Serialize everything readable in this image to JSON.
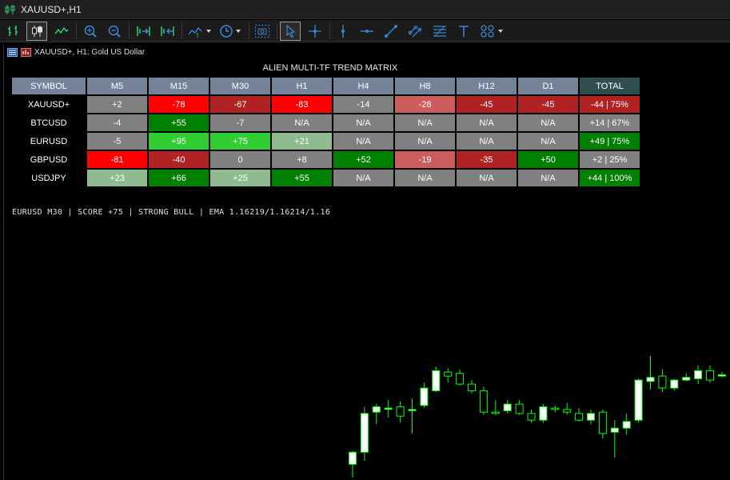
{
  "window": {
    "title": "XAUUSD+,H1"
  },
  "chart_header": {
    "text": "XAUUSD+, H1:  Gold US Dollar"
  },
  "matrix": {
    "title": "ALIEN MULTI-TF TREND MATRIX",
    "headers": [
      "SYMBOL",
      "M5",
      "M15",
      "M30",
      "H1",
      "H4",
      "H8",
      "H12",
      "D1",
      "TOTAL"
    ],
    "rows": [
      {
        "symbol": "XAUUSD+",
        "cells": [
          {
            "v": "+2",
            "c": "#808080"
          },
          {
            "v": "-78",
            "c": "#ff0000"
          },
          {
            "v": "-67",
            "c": "#b22222"
          },
          {
            "v": "-83",
            "c": "#ff0000"
          },
          {
            "v": "-14",
            "c": "#808080"
          },
          {
            "v": "-28",
            "c": "#cd5c5c"
          },
          {
            "v": "-45",
            "c": "#b22222"
          },
          {
            "v": "-45",
            "c": "#b22222"
          }
        ],
        "total": {
          "v": "-44 | 75%",
          "c": "#b22222"
        }
      },
      {
        "symbol": "BTCUSD",
        "cells": [
          {
            "v": "-4",
            "c": "#808080"
          },
          {
            "v": "+55",
            "c": "#008000"
          },
          {
            "v": "-7",
            "c": "#808080"
          },
          {
            "v": "N/A",
            "c": "#808080"
          },
          {
            "v": "N/A",
            "c": "#808080"
          },
          {
            "v": "N/A",
            "c": "#808080"
          },
          {
            "v": "N/A",
            "c": "#808080"
          },
          {
            "v": "N/A",
            "c": "#808080"
          }
        ],
        "total": {
          "v": "+14 | 67%",
          "c": "#808080"
        }
      },
      {
        "symbol": "EURUSD",
        "cells": [
          {
            "v": "-5",
            "c": "#808080"
          },
          {
            "v": "+95",
            "c": "#32cd32"
          },
          {
            "v": "+75",
            "c": "#32cd32"
          },
          {
            "v": "+21",
            "c": "#8fbc8f"
          },
          {
            "v": "N/A",
            "c": "#808080"
          },
          {
            "v": "N/A",
            "c": "#808080"
          },
          {
            "v": "N/A",
            "c": "#808080"
          },
          {
            "v": "N/A",
            "c": "#808080"
          }
        ],
        "total": {
          "v": "+49 | 75%",
          "c": "#008000"
        }
      },
      {
        "symbol": "GBPUSD",
        "cells": [
          {
            "v": "-81",
            "c": "#ff0000"
          },
          {
            "v": "-40",
            "c": "#b22222"
          },
          {
            "v": "0",
            "c": "#808080"
          },
          {
            "v": "+8",
            "c": "#808080"
          },
          {
            "v": "+52",
            "c": "#008000"
          },
          {
            "v": "-19",
            "c": "#cd5c5c"
          },
          {
            "v": "-35",
            "c": "#b22222"
          },
          {
            "v": "+50",
            "c": "#008000"
          }
        ],
        "total": {
          "v": "+2 | 25%",
          "c": "#808080"
        }
      },
      {
        "symbol": "USDJPY",
        "cells": [
          {
            "v": "+23",
            "c": "#8fbc8f"
          },
          {
            "v": "+66",
            "c": "#008000"
          },
          {
            "v": "+25",
            "c": "#8fbc8f"
          },
          {
            "v": "+55",
            "c": "#008000"
          },
          {
            "v": "N/A",
            "c": "#808080"
          },
          {
            "v": "N/A",
            "c": "#808080"
          },
          {
            "v": "N/A",
            "c": "#808080"
          },
          {
            "v": "N/A",
            "c": "#808080"
          }
        ],
        "total": {
          "v": "+44 | 100%",
          "c": "#008000"
        }
      }
    ]
  },
  "status": {
    "text": "EURUSD M30 | SCORE +75 | STRONG BULL | EMA 1.16219/1.16214/1.16"
  },
  "toolbar": {
    "icons": [
      "bar-chart-icon",
      "candlestick-icon",
      "line-chart-icon",
      "zoom-in-icon",
      "zoom-out-icon",
      "chart-shift-icon",
      "autoscroll-icon",
      "indicators-icon",
      "periods-icon",
      "screenshot-icon",
      "cursor-icon",
      "crosshair-icon",
      "vertical-line-icon",
      "horizontal-line-icon",
      "trendline-icon",
      "channel-icon",
      "fibonacci-icon",
      "text-icon",
      "shapes-icon"
    ]
  },
  "colors": {
    "accent": "#3a86d8",
    "bull_candle": "#ffffff",
    "wick": "#00ff00",
    "background": "#000000"
  },
  "candles": [
    {
      "o": 2.0,
      "h": 4.0,
      "l": 0,
      "c": 3.8
    },
    {
      "o": 3.8,
      "h": 10.6,
      "l": 2.5,
      "c": 9.6
    },
    {
      "o": 9.8,
      "h": 11.0,
      "l": 8.0,
      "c": 10.6
    },
    {
      "o": 10.4,
      "h": 11.6,
      "l": 9.0,
      "c": 10.4
    },
    {
      "o": 10.6,
      "h": 11.4,
      "l": 8.2,
      "c": 9.2
    },
    {
      "o": 10.2,
      "h": 11.8,
      "l": 6.6,
      "c": 10.2
    },
    {
      "o": 10.8,
      "h": 14.2,
      "l": 10.5,
      "c": 13.4
    },
    {
      "o": 13.0,
      "h": 16.6,
      "l": 12.8,
      "c": 16.0
    },
    {
      "o": 15.8,
      "h": 16.4,
      "l": 14.2,
      "c": 15.2
    },
    {
      "o": 15.6,
      "h": 16.2,
      "l": 13.8,
      "c": 14.0
    },
    {
      "o": 14.0,
      "h": 14.6,
      "l": 12.6,
      "c": 13.0
    },
    {
      "o": 13.0,
      "h": 13.6,
      "l": 9.4,
      "c": 9.8
    },
    {
      "o": 9.8,
      "h": 11.6,
      "l": 9.4,
      "c": 9.6
    },
    {
      "o": 10.0,
      "h": 11.6,
      "l": 9.6,
      "c": 11.0
    },
    {
      "o": 11.0,
      "h": 11.6,
      "l": 9.4,
      "c": 9.6
    },
    {
      "o": 9.6,
      "h": 10.2,
      "l": 8.2,
      "c": 8.6
    },
    {
      "o": 8.6,
      "h": 11.0,
      "l": 8.2,
      "c": 10.6
    },
    {
      "o": 10.4,
      "h": 10.8,
      "l": 9.8,
      "c": 10.2
    },
    {
      "o": 10.2,
      "h": 11.2,
      "l": 9.4,
      "c": 9.8
    },
    {
      "o": 9.6,
      "h": 10.4,
      "l": 8.4,
      "c": 8.6
    },
    {
      "o": 8.6,
      "h": 10.2,
      "l": 8.0,
      "c": 9.6
    },
    {
      "o": 9.8,
      "h": 10.2,
      "l": 5.8,
      "c": 6.6
    },
    {
      "o": 6.8,
      "h": 8.6,
      "l": 3.0,
      "c": 7.4
    },
    {
      "o": 7.4,
      "h": 9.6,
      "l": 6.4,
      "c": 8.4
    },
    {
      "o": 8.6,
      "h": 14.8,
      "l": 8.2,
      "c": 14.6
    },
    {
      "o": 14.4,
      "h": 18.2,
      "l": 13.2,
      "c": 15.0
    },
    {
      "o": 15.2,
      "h": 16.2,
      "l": 12.8,
      "c": 13.4
    },
    {
      "o": 13.4,
      "h": 14.8,
      "l": 13.0,
      "c": 14.6
    },
    {
      "o": 14.6,
      "h": 15.6,
      "l": 14.4,
      "c": 15.0
    },
    {
      "o": 14.8,
      "h": 16.8,
      "l": 14.0,
      "c": 16.0
    },
    {
      "o": 16.0,
      "h": 16.8,
      "l": 14.2,
      "c": 14.6
    },
    {
      "o": 15.2,
      "h": 15.8,
      "l": 15.0,
      "c": 15.4
    }
  ]
}
